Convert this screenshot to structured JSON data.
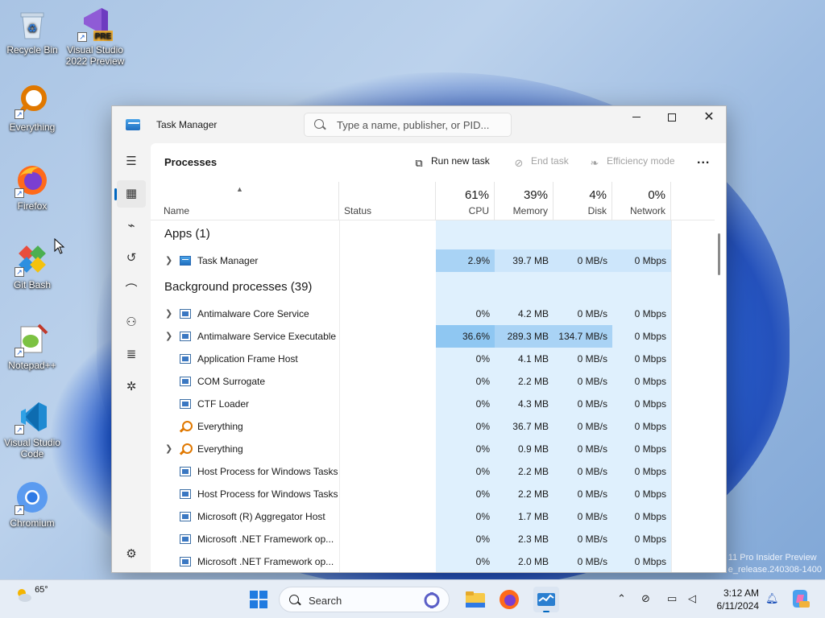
{
  "desktop": {
    "icons": [
      {
        "label": "Recycle Bin"
      },
      {
        "label": "Visual Studio 2022 Preview",
        "badge": "PRE"
      },
      {
        "label": "Everything"
      },
      {
        "label": "Firefox"
      },
      {
        "label": "Git Bash"
      },
      {
        "label": "Notepad++"
      },
      {
        "label": "Visual Studio Code"
      },
      {
        "label": "Chromium"
      }
    ],
    "watermark_line1": "11 Pro Insider Preview",
    "watermark_line2": "e_release.240308-1400"
  },
  "window": {
    "title": "Task Manager",
    "search_placeholder": "Type a name, publisher, or PID...",
    "page_title": "Processes",
    "commands": {
      "run_new_task": "Run new task",
      "end_task": "End task",
      "efficiency_mode": "Efficiency mode",
      "more": "..."
    },
    "columns": {
      "name": "Name",
      "status": "Status",
      "cpu": {
        "label": "CPU",
        "pct": "61%"
      },
      "memory": {
        "label": "Memory",
        "pct": "39%"
      },
      "disk": {
        "label": "Disk",
        "pct": "4%"
      },
      "network": {
        "label": "Network",
        "pct": "0%"
      }
    },
    "groups": {
      "apps": "Apps (1)",
      "background": "Background processes (39)"
    },
    "apps": [
      {
        "name": "Task Manager",
        "cpu": "2.9%",
        "memory": "39.7 MB",
        "disk": "0 MB/s",
        "network": "0 Mbps"
      }
    ],
    "background": [
      {
        "name": "Antimalware Core Service",
        "cpu": "0%",
        "memory": "4.2 MB",
        "disk": "0 MB/s",
        "network": "0 Mbps"
      },
      {
        "name": "Antimalware Service Executable",
        "cpu": "36.6%",
        "memory": "289.3 MB",
        "disk": "134.7 MB/s",
        "network": "0 Mbps"
      },
      {
        "name": "Application Frame Host",
        "cpu": "0%",
        "memory": "4.1 MB",
        "disk": "0 MB/s",
        "network": "0 Mbps"
      },
      {
        "name": "COM Surrogate",
        "cpu": "0%",
        "memory": "2.2 MB",
        "disk": "0 MB/s",
        "network": "0 Mbps"
      },
      {
        "name": "CTF Loader",
        "cpu": "0%",
        "memory": "4.3 MB",
        "disk": "0 MB/s",
        "network": "0 Mbps"
      },
      {
        "name": "Everything",
        "cpu": "0%",
        "memory": "36.7 MB",
        "disk": "0 MB/s",
        "network": "0 Mbps"
      },
      {
        "name": "Everything",
        "cpu": "0%",
        "memory": "0.9 MB",
        "disk": "0 MB/s",
        "network": "0 Mbps"
      },
      {
        "name": "Host Process for Windows Tasks",
        "cpu": "0%",
        "memory": "2.2 MB",
        "disk": "0 MB/s",
        "network": "0 Mbps"
      },
      {
        "name": "Host Process for Windows Tasks",
        "cpu": "0%",
        "memory": "2.2 MB",
        "disk": "0 MB/s",
        "network": "0 Mbps"
      },
      {
        "name": "Microsoft (R) Aggregator Host",
        "cpu": "0%",
        "memory": "1.7 MB",
        "disk": "0 MB/s",
        "network": "0 Mbps"
      },
      {
        "name": "Microsoft .NET Framework op...",
        "cpu": "0%",
        "memory": "2.3 MB",
        "disk": "0 MB/s",
        "network": "0 Mbps"
      },
      {
        "name": "Microsoft .NET Framework op...",
        "cpu": "0%",
        "memory": "2.0 MB",
        "disk": "0 MB/s",
        "network": "0 Mbps"
      }
    ]
  },
  "taskbar": {
    "weather_temp": "65°",
    "search_label": "Search",
    "time": "3:12 AM",
    "date": "6/11/2024"
  },
  "colors": {
    "accent": "#0067c0",
    "heat_light": "#dff0fd",
    "heat_high": "#a9d3f5"
  }
}
